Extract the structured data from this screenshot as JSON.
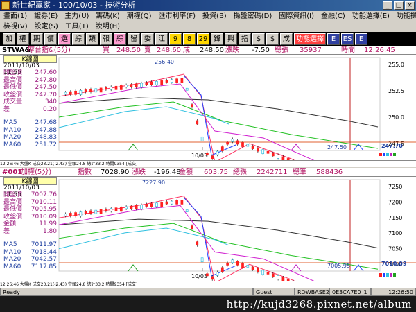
{
  "window": {
    "title": "新世紀贏家 - 100/10/03 - 技術分析"
  },
  "menu": {
    "row1": [
      "畫面(1)",
      "證券(E)",
      "主力(U)",
      "籌碼(K)",
      "期權(Q)",
      "匯市利率(F)",
      "投資(B)",
      "操盤密碼(D)",
      "國際資訊(I)",
      "金融(C)",
      "功能選擇(E)",
      "功能操作(F)"
    ],
    "row2": [
      "檢視(V)",
      "設定(S)",
      "工具(T)",
      "說明(H)"
    ]
  },
  "toolbar": {
    "buttons": [
      "加",
      "權",
      "期",
      "價",
      "選",
      "綜",
      "類",
      "報",
      "綜",
      "留",
      "委",
      "江",
      "9",
      "8",
      "29",
      "鋒",
      "興",
      "指",
      "$",
      "$",
      "成交",
      "E",
      "ES",
      "E"
    ],
    "wide_label": "功能選擇"
  },
  "top": {
    "header": {
      "symbol": "STWA&",
      "name": "摩台指&(5分)",
      "buy_label": "買",
      "buy": "248.50",
      "sell_label": "賣",
      "sell": "248.60",
      "trade_label": "成",
      "trade": "248.50",
      "change_label": "漲跌",
      "change": "-7.50",
      "volume_label": "總張",
      "volume": "35937",
      "time_label": "時間",
      "time": "12:26:45"
    },
    "info": {
      "title": "K線圖",
      "date": "2011/10/03 11:55",
      "rows": [
        {
          "k": "開盤價",
          "v": "247.60"
        },
        {
          "k": "最高價",
          "v": "247.80"
        },
        {
          "k": "最低價",
          "v": "247.50"
        },
        {
          "k": "收盤價",
          "v": "247.70"
        },
        {
          "k": "成交量",
          "v": "340"
        },
        {
          "k": "差",
          "v": "0.20"
        }
      ],
      "ma": [
        {
          "k": "MA5",
          "v": "247.68"
        },
        {
          "k": "MA10",
          "v": "247.88"
        },
        {
          "k": "MA20",
          "v": "248.83"
        },
        {
          "k": "MA60",
          "v": "251.72"
        }
      ]
    },
    "chart": {
      "high_label": "256.40",
      "low_label": "247.50",
      "date_label": "10/03",
      "last_label": "247.70",
      "y_ticks": [
        "255.0",
        "252.5",
        "250.0",
        "247.5"
      ]
    },
    "status": "12:26:46  大盤K  成交23.21(-2.43)  空頭24.8  總計33.2  時間9354 [成交]"
  },
  "bottom": {
    "header": {
      "symbol": "#001",
      "name": "加權(5分)",
      "index_label": "指數",
      "index": "7028.90",
      "change_label": "漲跌",
      "change": "-196.48",
      "amount_label": "金額",
      "amount": "603.75",
      "volume_label": "總張",
      "volume": "2242711",
      "count_label": "總筆",
      "count": "588436"
    },
    "info": {
      "title": "K線圖",
      "date": "2011/10/03 11:55",
      "rows": [
        {
          "k": "開盤價",
          "v": "7007.76"
        },
        {
          "k": "最高價",
          "v": "7010.11"
        },
        {
          "k": "最低價",
          "v": "7005.95"
        },
        {
          "k": "收盤價",
          "v": "7010.09"
        },
        {
          "k": "金額",
          "v": "11.99"
        },
        {
          "k": "差",
          "v": "1.80"
        }
      ],
      "ma": [
        {
          "k": "MA5",
          "v": "7011.97"
        },
        {
          "k": "MA10",
          "v": "7018.44"
        },
        {
          "k": "MA20",
          "v": "7042.57"
        },
        {
          "k": "MA60",
          "v": "7117.85"
        }
      ]
    },
    "chart": {
      "high_label": "7227.90",
      "low_label": "7005.95",
      "date_label": "10/03",
      "last_label": "7010.09",
      "y_ticks": [
        "7250",
        "7200",
        "7150",
        "7100",
        "7050",
        "7000"
      ]
    },
    "status": "12:26:46  大盤K  成交23.21(-2.43)  空頭24.8  總計33.2  時間9354 [成交]"
  },
  "statusbar": {
    "ready": "Ready",
    "user": "Guest",
    "mode": "ROWBASE2",
    "code": "0E3CA7E0_1",
    "time": "12:26:50"
  },
  "watermark": "http://kujd3268.pixnet.net/album",
  "colors": {
    "up": "#ff2020",
    "down": "#0080ff",
    "ma5": "#ff3060",
    "ma10": "#d020d0",
    "ma20": "#20c020",
    "ma60": "#303030",
    "hdr_price": "#b01060"
  }
}
